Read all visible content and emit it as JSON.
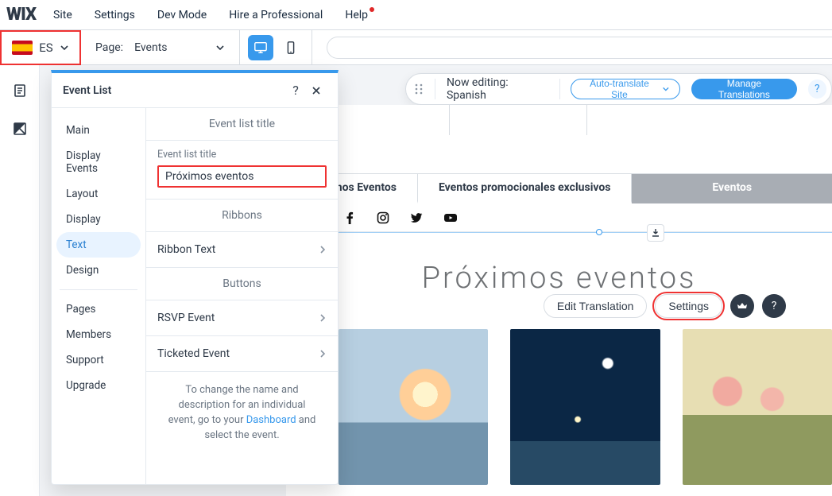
{
  "logo": "WIX",
  "menu": [
    "Site",
    "Settings",
    "Dev Mode",
    "Hire a Professional",
    "Help"
  ],
  "lang": {
    "code": "ES"
  },
  "page_selector": {
    "label": "Page:",
    "value": "Events"
  },
  "editing_bar": {
    "status": "Now editing: Spanish",
    "auto_translate": "Auto-translate Site",
    "manage": "Manage Translations",
    "help": "?"
  },
  "tabs": [
    "Próximos Eventos",
    "Eventos promocionales exclusivos",
    "Eventos"
  ],
  "headline": "Próximos eventos",
  "head_actions": {
    "edit": "Edit Translation",
    "settings": "Settings"
  },
  "panel": {
    "title": "Event List",
    "nav": [
      "Main",
      "Display Events",
      "Layout",
      "Display",
      "Text",
      "Design"
    ],
    "nav2": [
      "Pages",
      "Members",
      "Support",
      "Upgrade"
    ],
    "sections": {
      "event_list_title": "Event list title",
      "field_label": "Event list title",
      "field_value": "Próximos eventos",
      "ribbons": "Ribbons",
      "ribbon_text": "Ribbon Text",
      "buttons": "Buttons",
      "rsvp": "RSVP Event",
      "ticketed": "Ticketed Event"
    },
    "footer_pre": "To change the name and description for an individual event, go to your ",
    "footer_link": "Dashboard",
    "footer_post": " and select the event."
  }
}
